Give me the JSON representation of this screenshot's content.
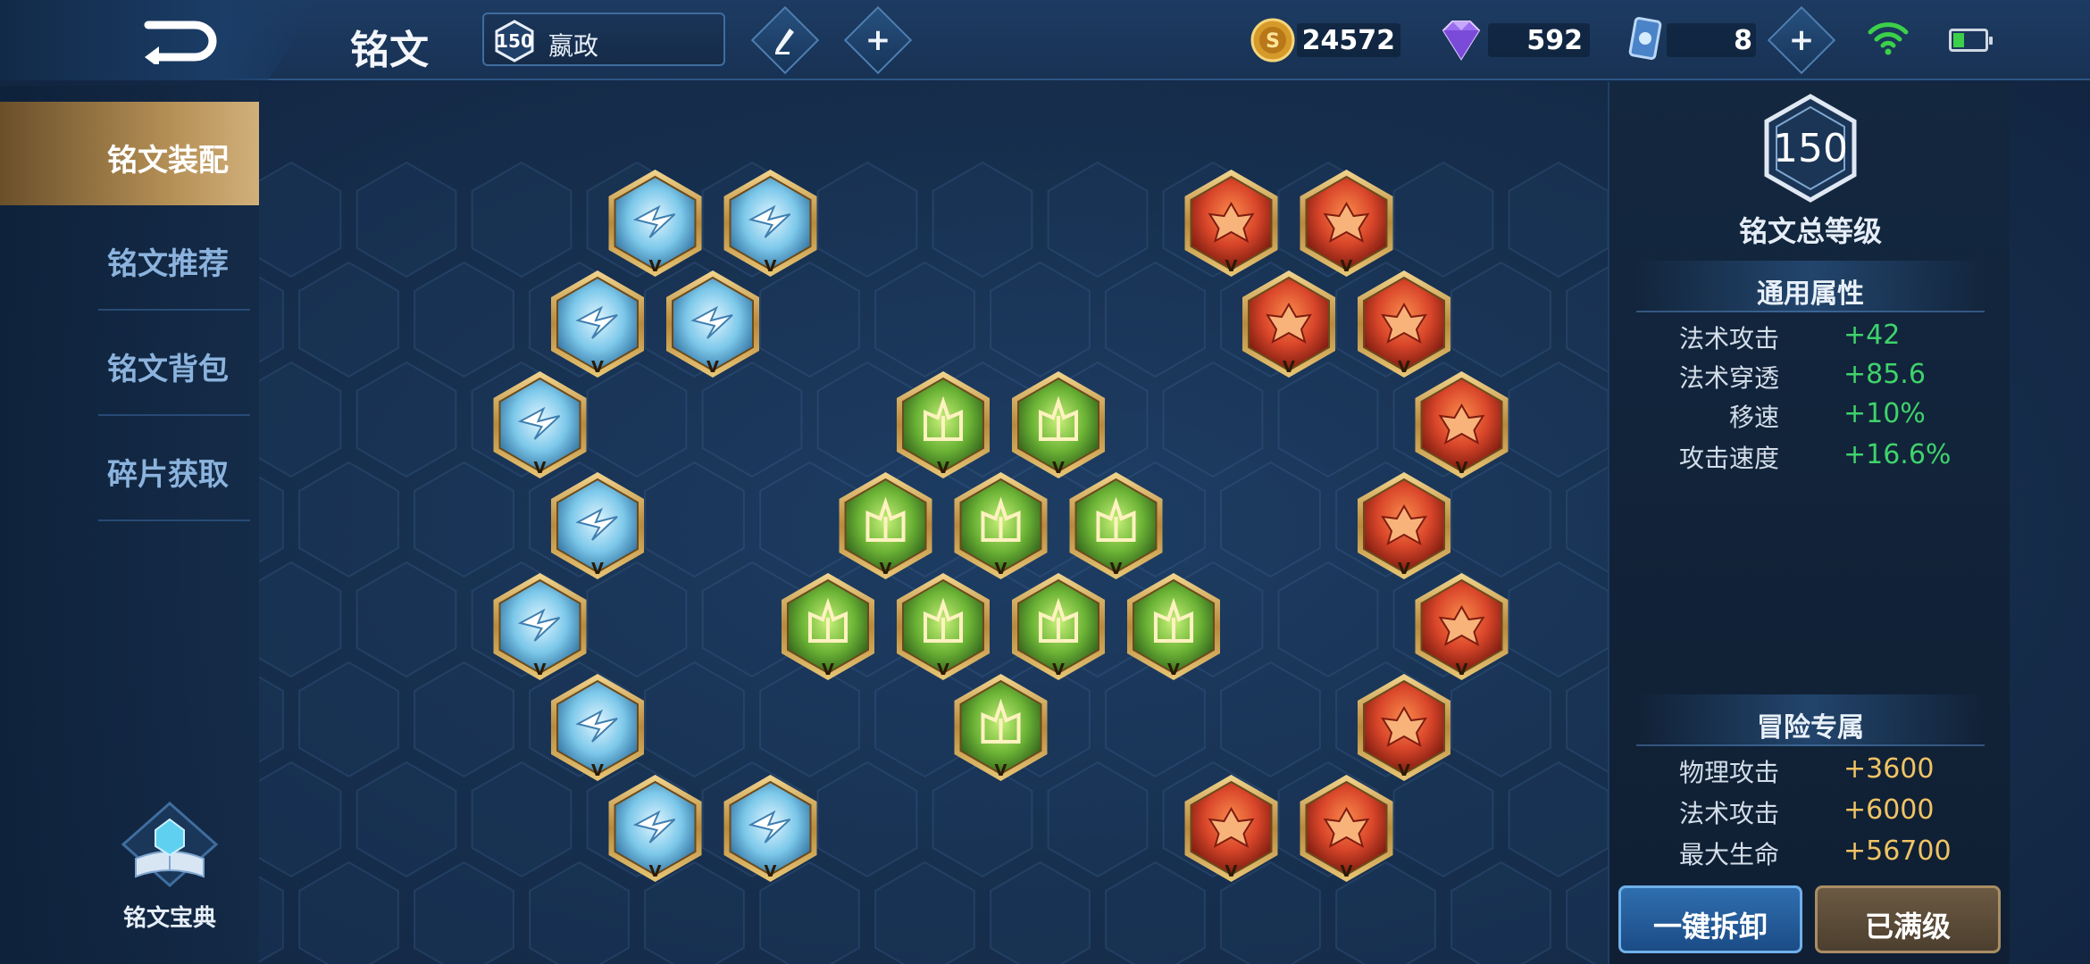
{
  "header": {
    "title": "铭文",
    "player": {
      "level": "150",
      "name": "嬴政"
    },
    "currencies": {
      "gold": "24572",
      "gems": "592",
      "tickets": "8"
    }
  },
  "sidebar": {
    "items": [
      {
        "label": "铭文装配",
        "active": true
      },
      {
        "label": "铭文推荐",
        "active": false
      },
      {
        "label": "铭文背包",
        "active": false
      },
      {
        "label": "碎片获取",
        "active": false
      }
    ],
    "codex_label": "铭文宝典"
  },
  "board": {
    "slot_level_mark": "V",
    "rune_colors": {
      "blue": "#7cc8ea",
      "green": "#7fc63f",
      "red": "#d9462a",
      "gold_frame": "#d7b46a"
    }
  },
  "panel": {
    "total_level": "150",
    "total_level_label": "铭文总等级",
    "general_title": "通用属性",
    "general_stats": [
      {
        "name": "法术攻击",
        "value": "+42"
      },
      {
        "name": "法术穿透",
        "value": "+85.6"
      },
      {
        "name": "移速",
        "value": "+10%"
      },
      {
        "name": "攻击速度",
        "value": "+16.6%"
      }
    ],
    "adventure_title": "冒险专属",
    "adventure_stats": [
      {
        "name": "物理攻击",
        "value": "+3600"
      },
      {
        "name": "法术攻击",
        "value": "+6000"
      },
      {
        "name": "最大生命",
        "value": "+56700"
      }
    ],
    "unload_button": "一键拆卸",
    "maxed_button": "已满级"
  }
}
